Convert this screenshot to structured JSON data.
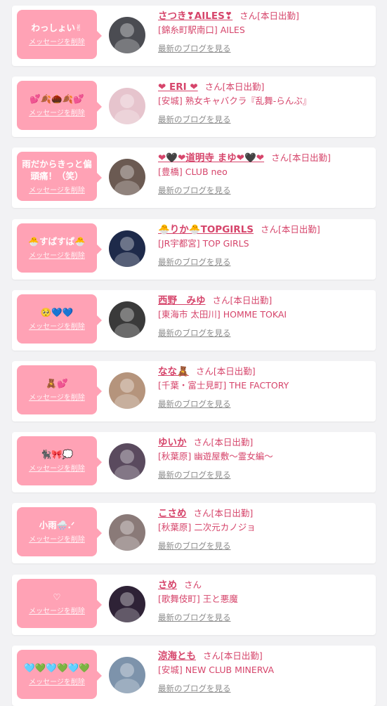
{
  "colors": {
    "accent": "#d6456b",
    "bubble": "#ffa2b5",
    "card": "#ffffff",
    "background": "#f2f2f4",
    "link_gray": "#8c8c8c"
  },
  "entries": [
    {
      "message": "わっしょい✌",
      "delete_label": "メッセージを削除",
      "name": "さつき❣AILES❣",
      "honorific": "さん[本日出勤]",
      "shop": "[錦糸町駅南口] AILES",
      "blog_link": "最新のブログを見る",
      "avatar_color": "#4b4c52"
    },
    {
      "message": "💕🍂🌰🍂💕",
      "delete_label": "メッセージを削除",
      "name": "❤ ERI ❤",
      "honorific": "さん[本日出勤]",
      "shop": "[安城] 熟女キャバクラ『乱舞-らんぶ』",
      "blog_link": "最新のブログを見る",
      "avatar_color": "#e6c4cd"
    },
    {
      "message": "雨だからきっと偏頭痛！（笑）",
      "delete_label": "メッセージを削除",
      "name": "❤🖤❤道明寺 まゆ❤🖤❤",
      "honorific": "さん[本日出勤]",
      "shop": "[豊橋] CLUB neo",
      "blog_link": "最新のブログを見る",
      "avatar_color": "#6b5a52"
    },
    {
      "message": "🐣すぱすぱ🐣",
      "delete_label": "メッセージを削除",
      "name": "🐣りか🐣TOPGIRLS",
      "honorific": "さん[本日出勤]",
      "shop": "[JR宇都宮] TOP GIRLS",
      "blog_link": "最新のブログを見る",
      "avatar_color": "#1e2a4a"
    },
    {
      "message": "🥺💙💙",
      "delete_label": "メッセージを削除",
      "name": "西野　みゆ",
      "honorific": "さん[本日出勤]",
      "shop": "[東海市 太田川] HOMME TOKAI",
      "blog_link": "最新のブログを見る",
      "avatar_color": "#3a3a3a"
    },
    {
      "message": "🧸💕",
      "delete_label": "メッセージを削除",
      "name": "なな🧸",
      "honorific": "さん[本日出勤]",
      "shop": "[千葉・富士見町] THE FACTORY",
      "blog_link": "最新のブログを見る",
      "avatar_color": "#b5947c"
    },
    {
      "message": "🐈‍⬛🎀💭",
      "delete_label": "メッセージを削除",
      "name": "ゆいか",
      "honorific": "さん[本日出勤]",
      "shop": "[秋葉原] 幽遊屋敷〜霊女編〜",
      "blog_link": "最新のブログを見る",
      "avatar_color": "#5a4a5e"
    },
    {
      "message": "小雨🌧️.ᐟ",
      "delete_label": "メッセージを削除",
      "name": "こさめ",
      "honorific": "さん[本日出勤]",
      "shop": "[秋葉原] 二次元カノジョ",
      "blog_link": "最新のブログを見る",
      "avatar_color": "#8a7a78"
    },
    {
      "message": "♡",
      "delete_label": "メッセージを削除",
      "name": "さめ",
      "honorific": "さん",
      "shop": "[歌舞伎町] 王と悪魔",
      "blog_link": "最新のブログを見る",
      "avatar_color": "#2e2236"
    },
    {
      "message": "🩵💚🩵💚🩵💚",
      "delete_label": "メッセージを削除",
      "name": "涼海とも",
      "honorific": "さん[本日出勤]",
      "shop": "[安城] NEW CLUB MINERVA",
      "blog_link": "最新のブログを見る",
      "avatar_color": "#7d93ab"
    }
  ]
}
